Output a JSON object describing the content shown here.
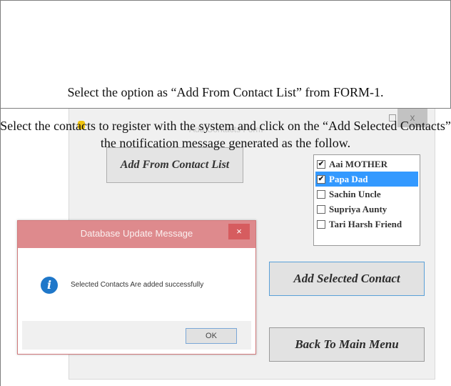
{
  "doc": {
    "line1": "Select the option as “Add From Contact List” from FORM-1.",
    "line2": "Select the contacts to register with the system and click on the “Add Selected Contacts” the notification message generated as the follow."
  },
  "form": {
    "caption": "Add Contacts Form",
    "close_glyph": "x",
    "add_from_label": "Add From Contact List",
    "contacts": [
      {
        "label": "Aai MOTHER",
        "checked": true,
        "selected": false
      },
      {
        "label": "Papa Dad",
        "checked": true,
        "selected": true
      },
      {
        "label": "Sachin Uncle",
        "checked": false,
        "selected": false
      },
      {
        "label": "Supriya Aunty",
        "checked": false,
        "selected": false
      },
      {
        "label": "Tari Harsh Friend",
        "checked": false,
        "selected": false
      }
    ],
    "add_selected_label": "Add Selected Contact",
    "back_label": "Back To Main Menu"
  },
  "dialog": {
    "title": "Database Update Message",
    "close_glyph": "×",
    "message": "Selected Contacts Are added successfully",
    "ok_label": "OK",
    "info_icon": "information-icon"
  },
  "colors": {
    "dialog_title_bar": "#de8a8d",
    "selection_highlight": "#3399ff",
    "info_icon": "#1f77c9"
  }
}
